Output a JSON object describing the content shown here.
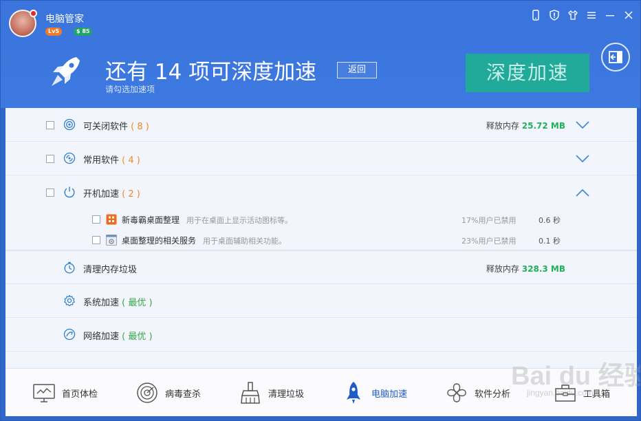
{
  "app": {
    "title": "电脑管家",
    "level": "Lv5",
    "coins": "$ 85"
  },
  "window_controls": [
    "phone-icon",
    "shield-icon",
    "shirt-icon",
    "menu-icon",
    "minimize-icon",
    "close-icon"
  ],
  "hero": {
    "headline": "还有 14 项可深度加速",
    "subline": "请勾选加速项",
    "back_label": "返回",
    "deep_label": "深度加速"
  },
  "sections": {
    "closable": {
      "label": "可关闭软件",
      "count": "( 8 )",
      "mem_label": "释放内存",
      "mem_value": "25.72 MB"
    },
    "common": {
      "label": "常用软件",
      "count": "( 4 )"
    },
    "startup": {
      "label": "开机加速",
      "count": "( 2 )",
      "items": [
        {
          "name": "新毒霸桌面整理",
          "desc": "用于在桌面上显示活动图标等。",
          "pct": "17%用户已禁用",
          "time": "0.6 秒"
        },
        {
          "name": "桌面整理的相关服务",
          "desc": "用于桌面辅助相关功能。",
          "pct": "23%用户已禁用",
          "time": "0.1 秒"
        }
      ]
    },
    "memory": {
      "label": "清理内存垃圾",
      "mem_label": "释放内存",
      "mem_value": "328.3 MB"
    },
    "system": {
      "label": "系统加速",
      "status": "( 最优 )"
    },
    "network": {
      "label": "网络加速",
      "status": "( 最优 )"
    }
  },
  "bottom_nav": [
    {
      "label": "首页体检",
      "icon": "monitor-icon"
    },
    {
      "label": "病毒查杀",
      "icon": "radar-icon"
    },
    {
      "label": "清理垃圾",
      "icon": "broom-icon"
    },
    {
      "label": "电脑加速",
      "icon": "rocket-icon"
    },
    {
      "label": "软件分析",
      "icon": "clover-icon"
    },
    {
      "label": "工具箱",
      "icon": "toolbox-icon"
    }
  ],
  "watermark": {
    "text": "Bai du 经验",
    "sub": "jingyan.baidu.com"
  },
  "colors": {
    "header_blue": "#3a74dc",
    "deep_button": "#21a99a",
    "count_orange": "#f18a1c",
    "mem_green": "#1fb15c",
    "best_green": "#37a84a",
    "active_nav": "#1e5cc8"
  }
}
